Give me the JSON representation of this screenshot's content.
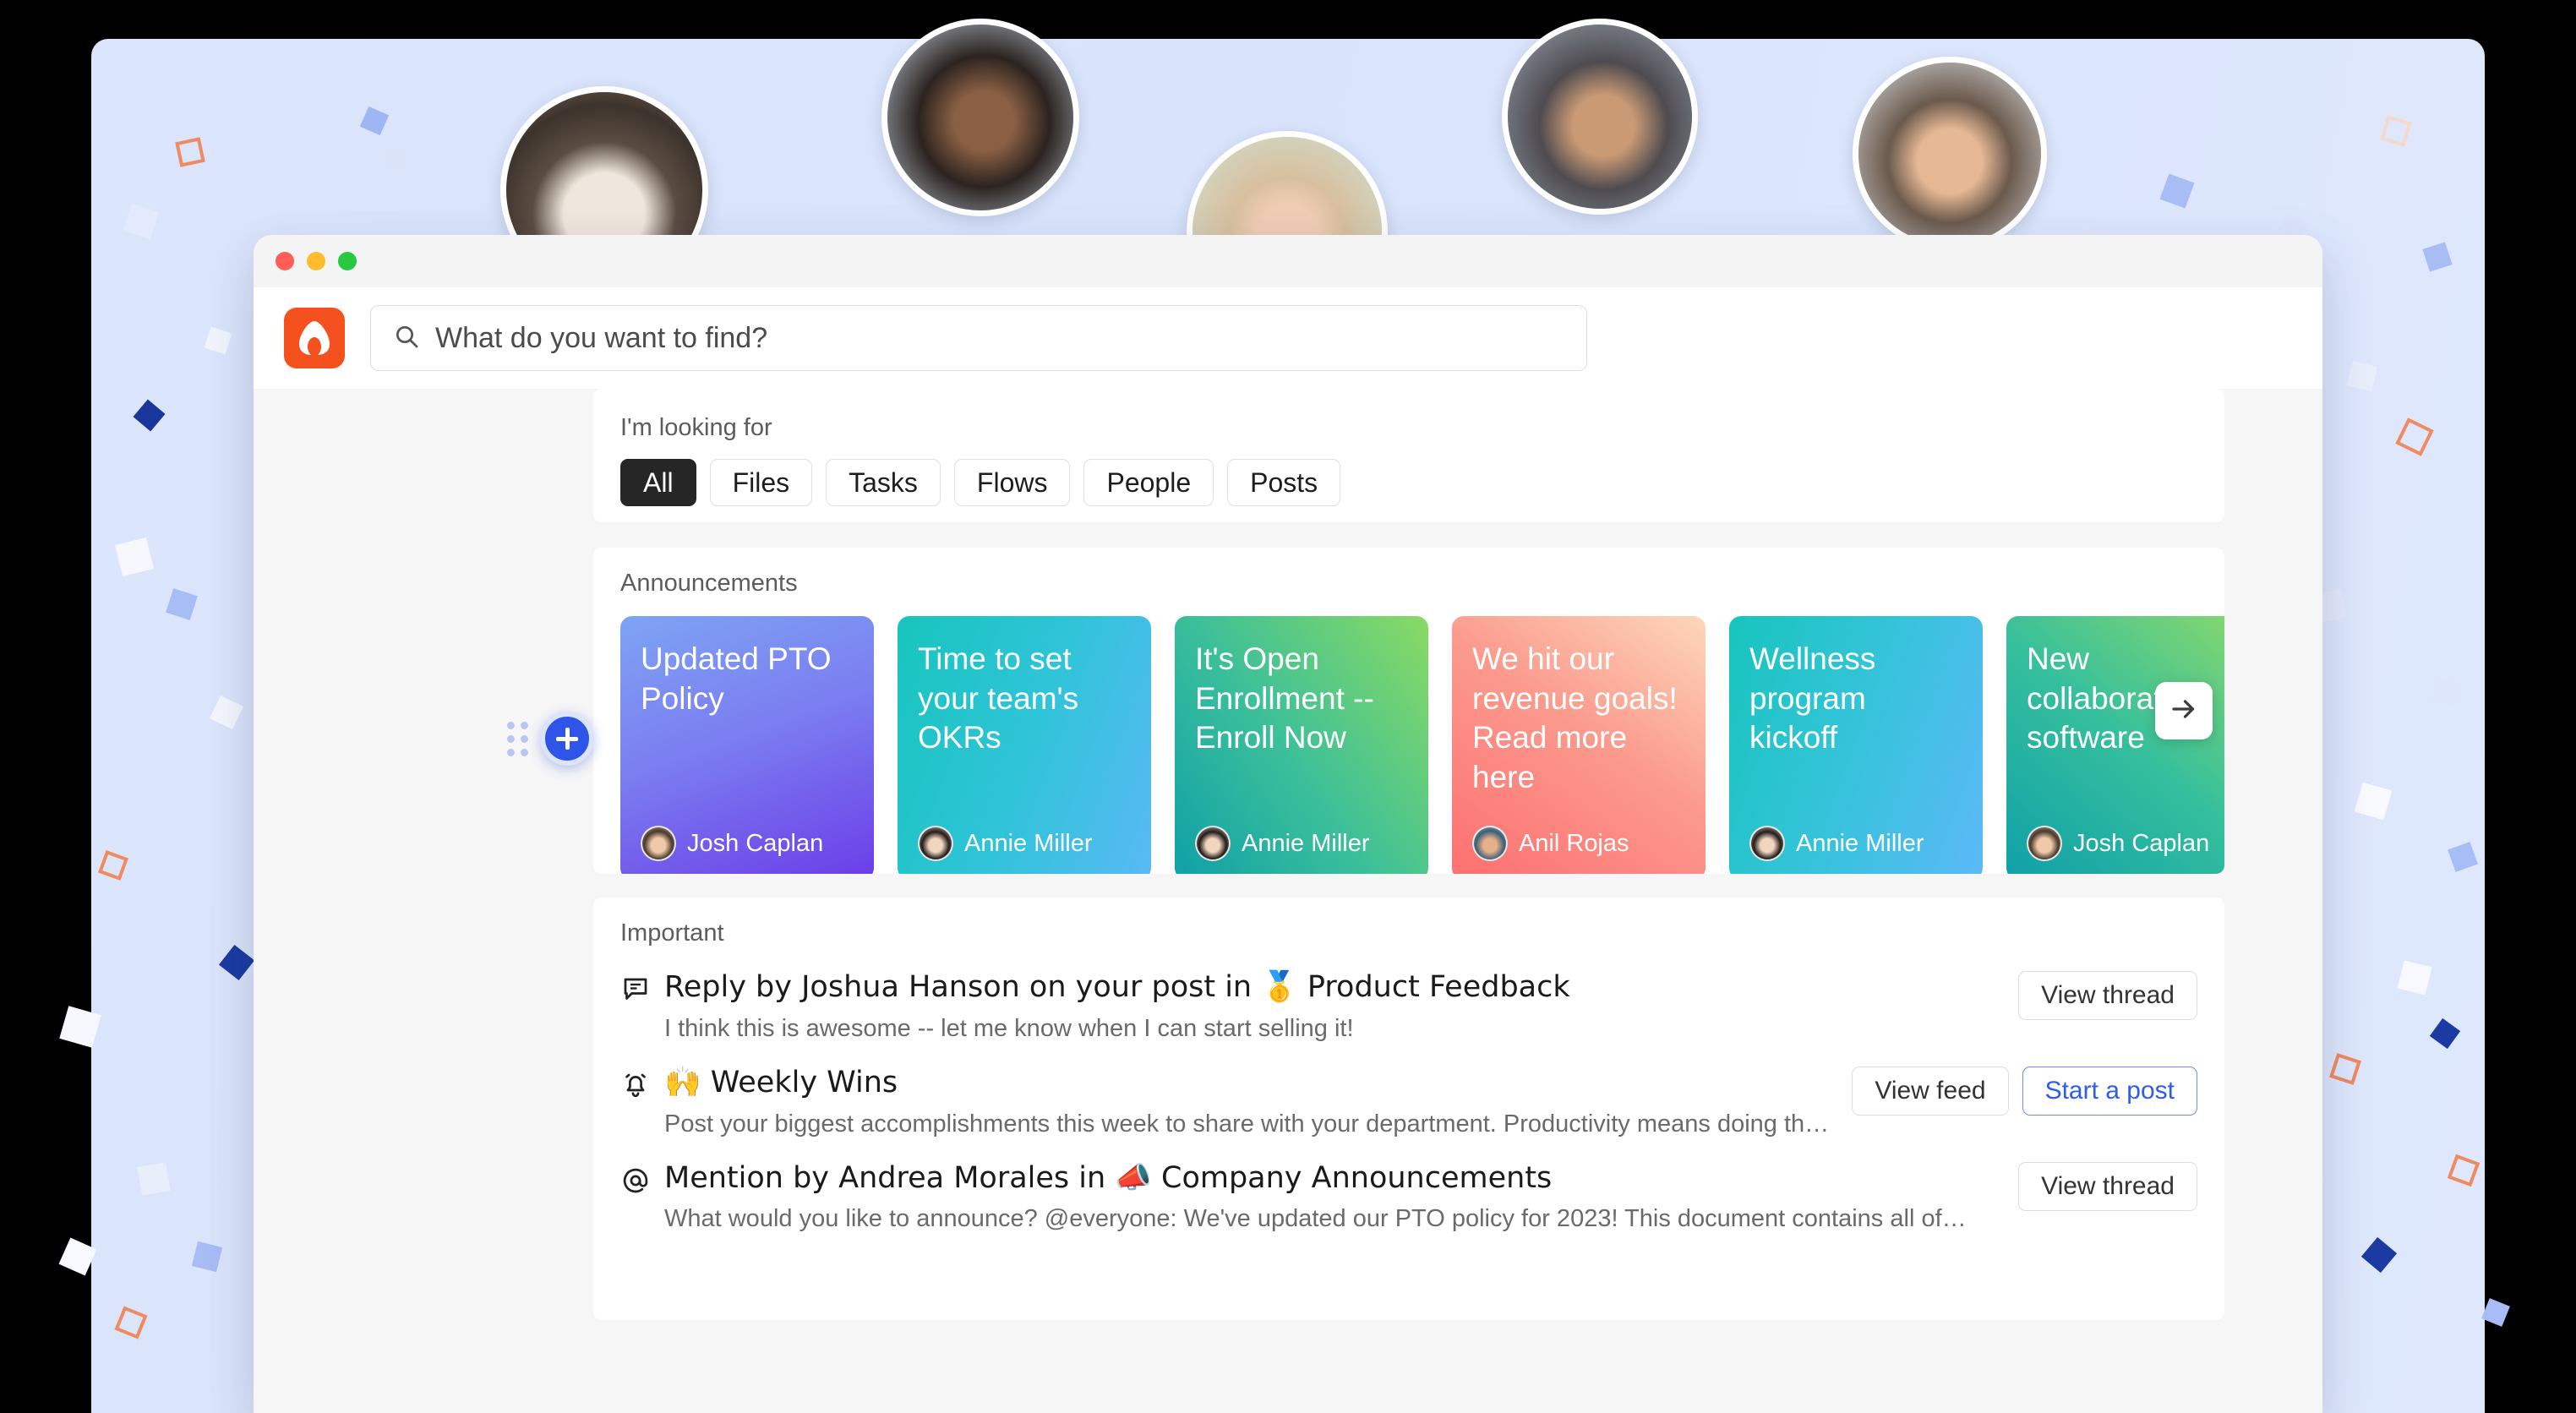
{
  "window": {
    "traffic_lights": [
      "close",
      "minimize",
      "maximize"
    ]
  },
  "brand": {
    "logo_name": "assembly-logo",
    "logo_color": "#f4511e"
  },
  "search": {
    "placeholder": "What do you want to find?",
    "value": "",
    "icon": "search-icon"
  },
  "fab": {
    "icon": "plus-icon",
    "drag_handle": "drag-dots-icon",
    "color": "#2f55e8"
  },
  "looking_for": {
    "label": "I'm looking for",
    "pills": [
      {
        "label": "All",
        "active": true
      },
      {
        "label": "Files",
        "active": false
      },
      {
        "label": "Tasks",
        "active": false
      },
      {
        "label": "Flows",
        "active": false
      },
      {
        "label": "People",
        "active": false
      },
      {
        "label": "Posts",
        "active": false
      }
    ]
  },
  "announcements": {
    "label": "Announcements",
    "next_icon": "arrow-right-icon",
    "cards": [
      {
        "title": "Updated PTO Policy",
        "author": "Josh Caplan",
        "gradient": "linear-gradient(160deg,#7ea4f4 0%,#7b7ef0 45%,#6b3de8 100%)"
      },
      {
        "title": "Time to set your team's OKRs",
        "author": "Annie Miller",
        "gradient": "linear-gradient(110deg,#17c5bd 0%,#2fc4d8 50%,#59b9f5 100%)"
      },
      {
        "title": "It's Open Enrollment -- Enroll Now",
        "author": "Annie Miller",
        "gradient": "linear-gradient(55deg,#0fa0a8 0%,#3bbf9a 45%,#8ada63 100%)"
      },
      {
        "title": "We hit our revenue goals! Read more here",
        "author": "Anil Rojas",
        "gradient": "linear-gradient(215deg,#fdd7bb 0%,#fb9a8d 45%,#fd6f70 100%)"
      },
      {
        "title": "Wellness program kickoff",
        "author": "Annie Miller",
        "gradient": "linear-gradient(110deg,#17c5bd 0%,#36c3db 50%,#5cb9f7 100%)"
      },
      {
        "title": "New collaboration software",
        "author": "Josh Caplan",
        "gradient": "linear-gradient(40deg,#0fa0a8 0%,#35bf9d 50%,#8cd96b 100%)"
      }
    ]
  },
  "important": {
    "label": "Important",
    "items": [
      {
        "icon": "comment-icon",
        "emoji": "",
        "title": "Reply by Joshua Hanson on your post in 🥇 Product Feedback",
        "subtitle": "I think this is awesome -- let me know when I can start selling it!",
        "actions": [
          {
            "label": "View thread",
            "primary": false
          }
        ]
      },
      {
        "icon": "bell-icon",
        "emoji": "",
        "title": "🙌 Weekly Wins",
        "subtitle": "Post your biggest accomplishments this week to share with your department. Productivity means doing the…",
        "actions": [
          {
            "label": "View feed",
            "primary": false
          },
          {
            "label": "Start a post",
            "primary": true
          }
        ]
      },
      {
        "icon": "mention-icon",
        "emoji": "",
        "title": "Mention by Andrea Morales in 📣 Company Announcements",
        "subtitle": "What would you like to announce? @everyone: We've updated our PTO policy for 2023! This document contains all of…",
        "actions": [
          {
            "label": "View thread",
            "primary": false
          }
        ]
      }
    ]
  },
  "hero_avatars": [
    {
      "name": "husky-dog-avatar"
    },
    {
      "name": "woman-braids-avatar"
    },
    {
      "name": "woman-glasses-avatar"
    },
    {
      "name": "man-headset-waving-avatar"
    },
    {
      "name": "man-headset-avatar"
    }
  ]
}
